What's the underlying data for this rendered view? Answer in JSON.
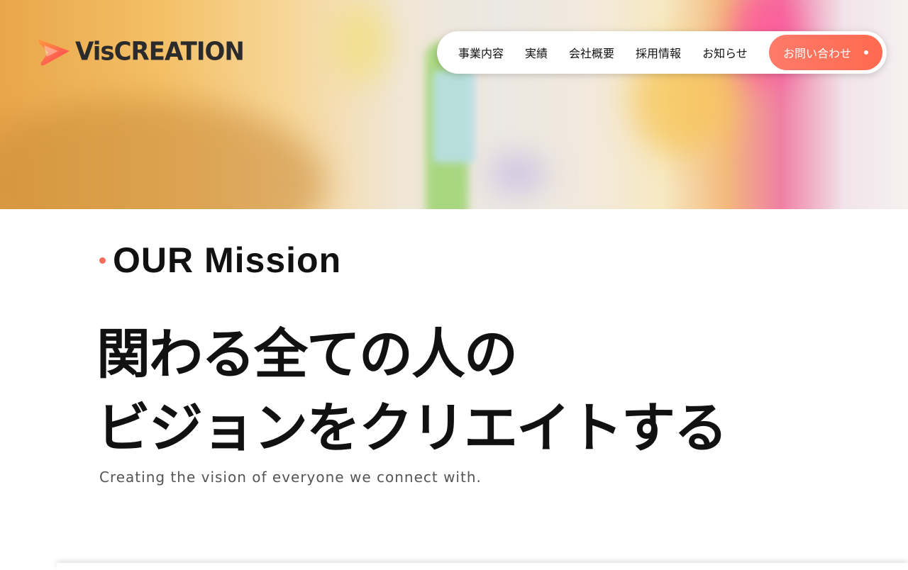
{
  "brand": {
    "logo_text": "VisCREATION",
    "accent_color": "#f26d5c"
  },
  "nav": {
    "items": [
      {
        "label": "事業内容"
      },
      {
        "label": "実績"
      },
      {
        "label": "会社概要"
      },
      {
        "label": "採用情報"
      },
      {
        "label": "お知らせ"
      }
    ],
    "cta_label": "お問い合わせ"
  },
  "mission": {
    "heading": "OUR Mission",
    "headline_line1": "関わる全ての人の",
    "headline_line2": "ビジョンをクリエイトする",
    "subtitle": "Creating the vision of everyone we connect with."
  }
}
